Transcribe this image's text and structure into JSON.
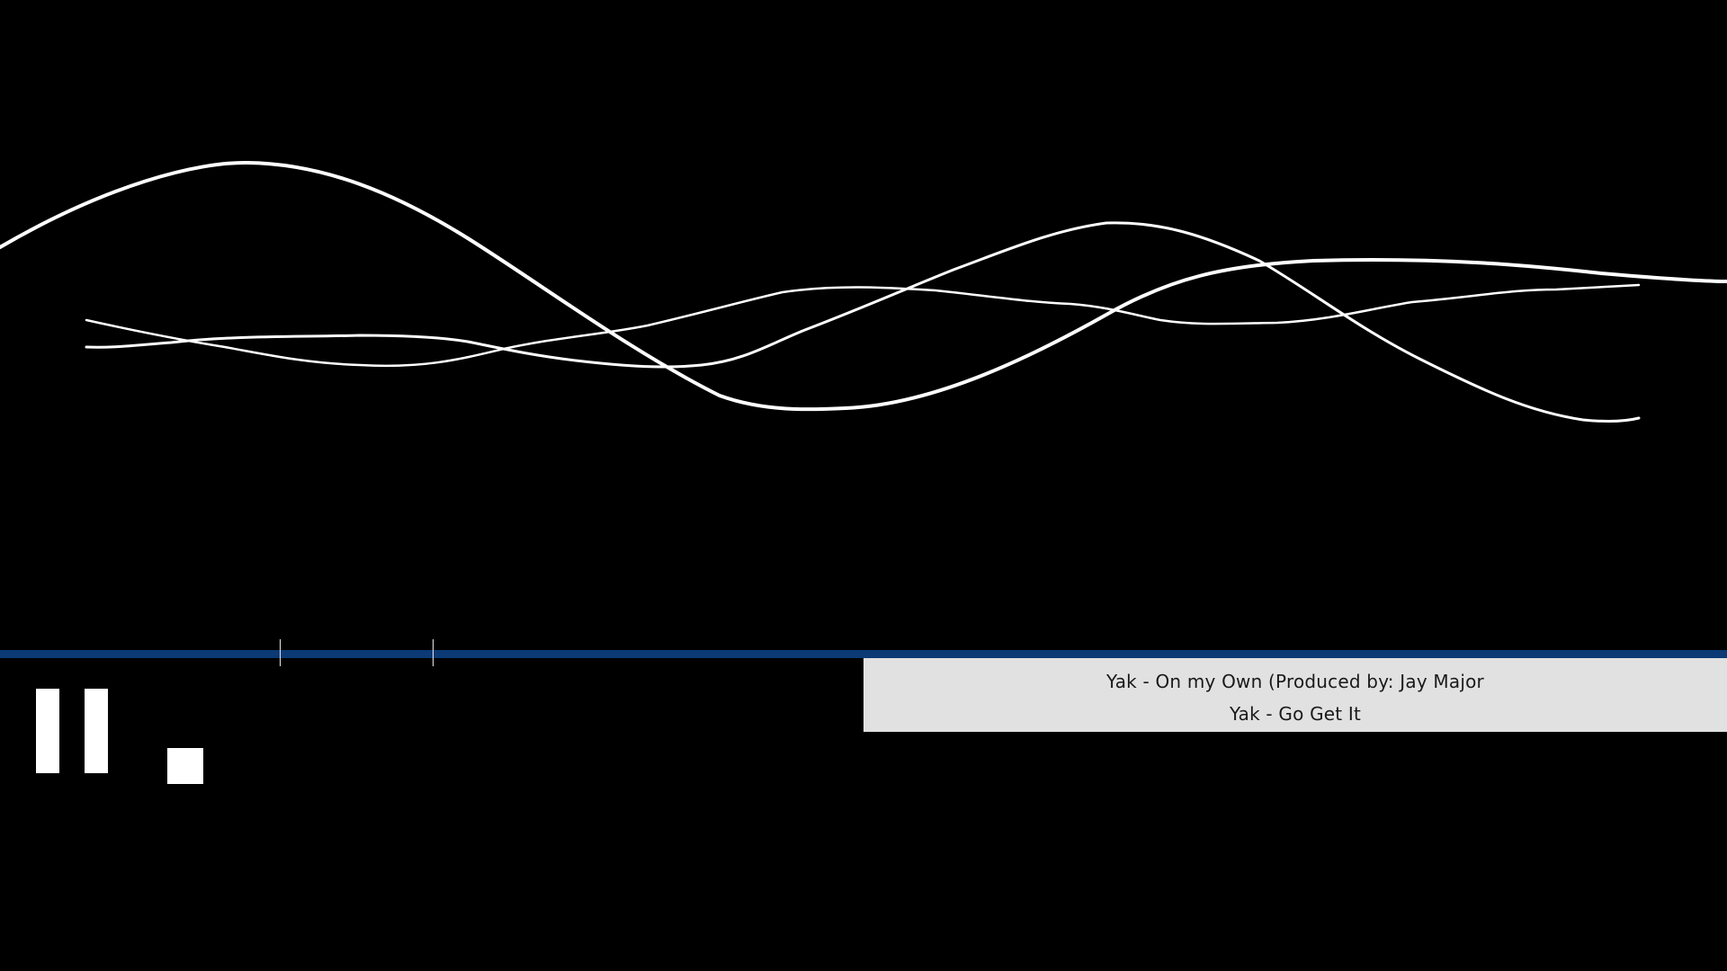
{
  "colors": {
    "background": "#000000",
    "wave_stroke": "#ffffff",
    "timeline": "#0b3a75",
    "playlist_background": "#e1e1e1",
    "playlist_text": "#1a1a1a"
  },
  "controls": {
    "pause_icon": "pause-icon",
    "stop_icon": "stop-icon"
  },
  "playlist": {
    "tracks": [
      {
        "title": "Yak - On my Own (Produced by: Jay Major"
      },
      {
        "title": "Yak - Go Get It"
      }
    ]
  }
}
